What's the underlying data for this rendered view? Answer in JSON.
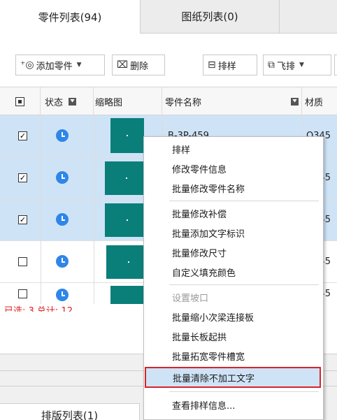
{
  "tabs": {
    "parts_tab": "零件列表(94)",
    "drawings_tab": "图纸列表(0)"
  },
  "toolbar": {
    "add_part": "添加零件",
    "delete": "删除",
    "nest": "排样",
    "fly_cut": "飞排"
  },
  "table": {
    "headers": {
      "status": "状态",
      "thumbnail": "缩略图",
      "part_name": "零件名称",
      "material": "材质"
    },
    "rows": [
      {
        "checked": true,
        "check_mark": "✓",
        "name": "B-3P-459",
        "material": "Q345"
      },
      {
        "checked": true,
        "check_mark": "✓",
        "name": "",
        "material": "Q345"
      },
      {
        "checked": true,
        "check_mark": "✓",
        "name": "",
        "material": "Q345"
      },
      {
        "checked": false,
        "check_mark": "",
        "name": "",
        "material": "Q345"
      },
      {
        "checked": false,
        "check_mark": "",
        "name": "",
        "material": "Q345"
      }
    ],
    "summary": "已选: 3 总计: 12"
  },
  "context_menu": {
    "items": [
      "排样",
      "修改零件信息",
      "批量修改零件名称",
      "批量修改补偿",
      "批量添加文字标识",
      "批量修改尺寸",
      "自定义填充颜色",
      "设置坡口",
      "批量缩小次梁连接板",
      "批量长板起拱",
      "批量拓宽零件槽宽",
      "批量清除不加工文字",
      "查看排样信息..."
    ],
    "highlighted": "批量清除不加工文字",
    "disabled": "设置坡口"
  },
  "bottom_tab": "排版列表(1)",
  "colors": {
    "selected_row": "#cfe3f7",
    "thumbnail": "#0a7f7a",
    "status_icon": "#2f86e8",
    "summary_text": "#e02020",
    "highlight_border": "#d8232a"
  }
}
